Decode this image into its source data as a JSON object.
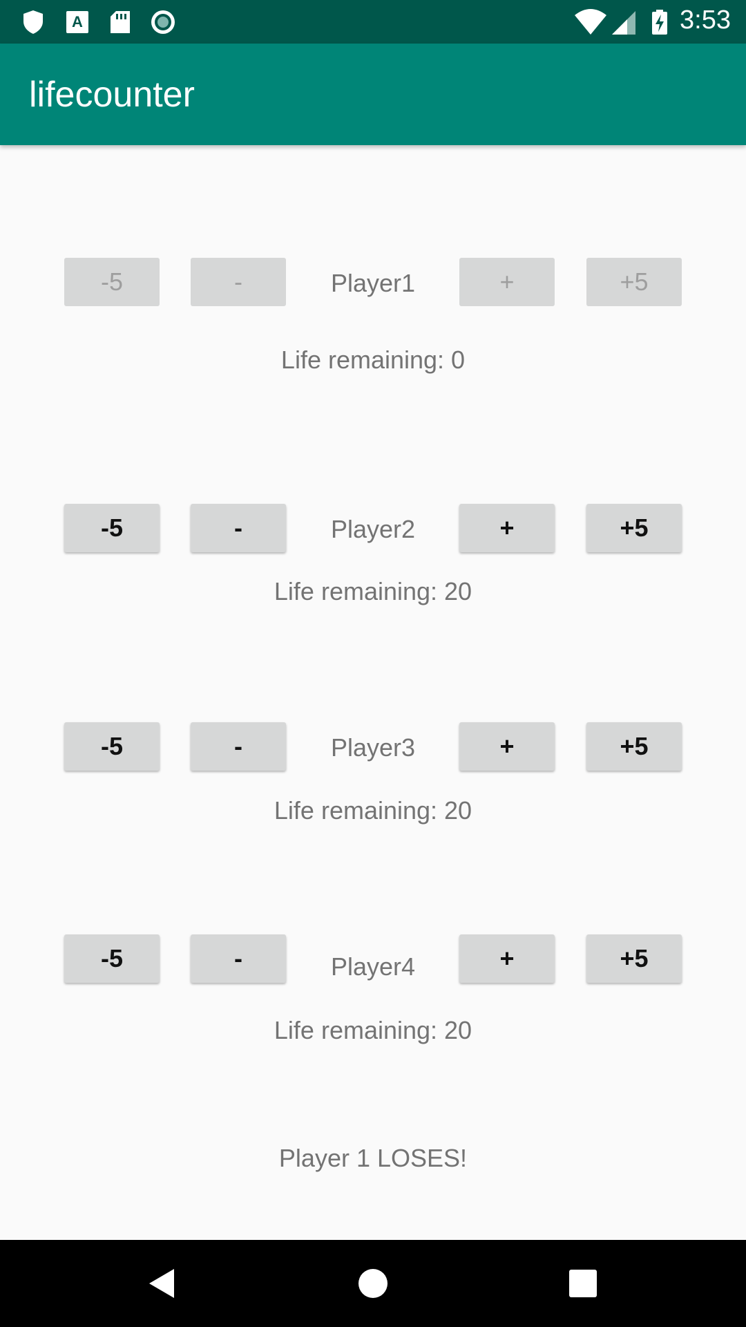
{
  "status_bar": {
    "time": "3:53",
    "left_icons": [
      "shield-icon",
      "app-a-icon",
      "sd-card-icon",
      "record-icon"
    ],
    "right_icons": [
      "wifi-icon",
      "signal-icon",
      "battery-charging-icon"
    ]
  },
  "app_bar": {
    "title": "lifecounter",
    "color": "#008577"
  },
  "players": [
    {
      "name": "Player1",
      "life_text": "Life remaining: 0",
      "minus5": "-5",
      "minus1": "-",
      "plus1": "+",
      "plus5": "+5",
      "enabled": false
    },
    {
      "name": "Player2",
      "life_text": "Life remaining: 20",
      "minus5": "-5",
      "minus1": "-",
      "plus1": "+",
      "plus5": "+5",
      "enabled": true
    },
    {
      "name": "Player3",
      "life_text": "Life remaining: 20",
      "minus5": "-5",
      "minus1": "-",
      "plus1": "+",
      "plus5": "+5",
      "enabled": true
    },
    {
      "name": "Player4",
      "life_text": "Life remaining: 20",
      "minus5": "-5",
      "minus1": "-",
      "plus1": "+",
      "plus5": "+5",
      "enabled": true
    }
  ],
  "message": "Player 1 LOSES!",
  "nav_bar": {
    "icons": [
      "back-icon",
      "home-icon",
      "recents-icon"
    ]
  }
}
